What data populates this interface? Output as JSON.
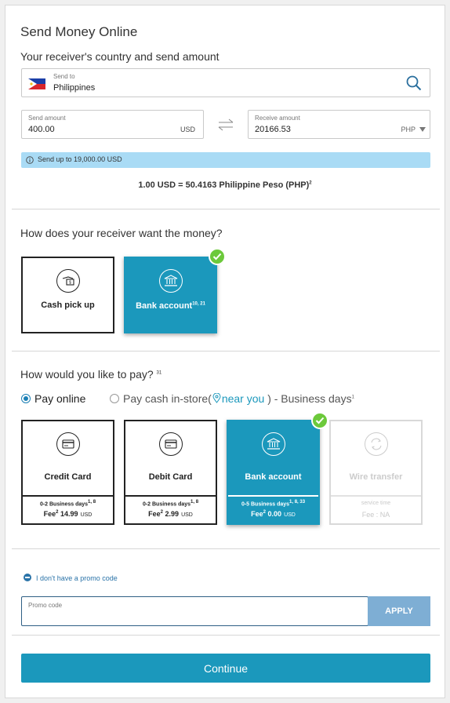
{
  "page": {
    "title": "Send Money Online"
  },
  "amount_section": {
    "heading": "Your receiver's country and send amount",
    "send_to": {
      "label": "Send to",
      "value": "Philippines"
    },
    "send_amount": {
      "label": "Send amount",
      "value": "400.00",
      "currency": "USD"
    },
    "receive_amount": {
      "label": "Receive amount",
      "value": "20166.53",
      "currency": "PHP"
    },
    "limit_notice": "Send up to 19,000.00 USD",
    "rate": {
      "text": "1.00 USD = 50.4163 Philippine Peso (PHP)",
      "footnote": "2"
    }
  },
  "receive_section": {
    "heading": "How does your receiver want the money?",
    "options": [
      {
        "label": "Cash pick up",
        "footnote": "",
        "selected": false
      },
      {
        "label": "Bank account",
        "footnote": "10, 21",
        "selected": true
      }
    ]
  },
  "pay_section": {
    "heading": "How would you like to pay?",
    "heading_note": "31",
    "pay_online": "Pay online",
    "pay_cash_prefix": "Pay cash in-store(",
    "pay_cash_link": "near you",
    "pay_cash_suffix": ") - Business days",
    "pay_cash_note": "1",
    "options": [
      {
        "label": "Credit Card",
        "days": "0-2 Business days",
        "days_note": "1, 8",
        "fee_label": "Fee",
        "fee_note": "2",
        "fee": "14.99",
        "currency": "USD",
        "state": "normal"
      },
      {
        "label": "Debit Card",
        "days": "0-2 Business days",
        "days_note": "1, 8",
        "fee_label": "Fee",
        "fee_note": "2",
        "fee": "2.99",
        "currency": "USD",
        "state": "normal"
      },
      {
        "label": "Bank account",
        "days": "0-5 Business days",
        "days_note": "1, 8, 33",
        "fee_label": "Fee",
        "fee_note": "2",
        "fee": "0.00",
        "currency": "USD",
        "state": "selected"
      },
      {
        "label": "Wire transfer",
        "days": "service time",
        "fee_text": "Fee : NA",
        "state": "disabled"
      }
    ]
  },
  "promo": {
    "toggle": "I don't have a promo code",
    "label": "Promo code",
    "value": "",
    "apply": "APPLY"
  },
  "continue_label": "Continue",
  "colors": {
    "accent": "#1b98bc",
    "success": "#6cc93b",
    "notice_bg": "#a9dbf5",
    "apply_bg": "#7eaed4"
  }
}
